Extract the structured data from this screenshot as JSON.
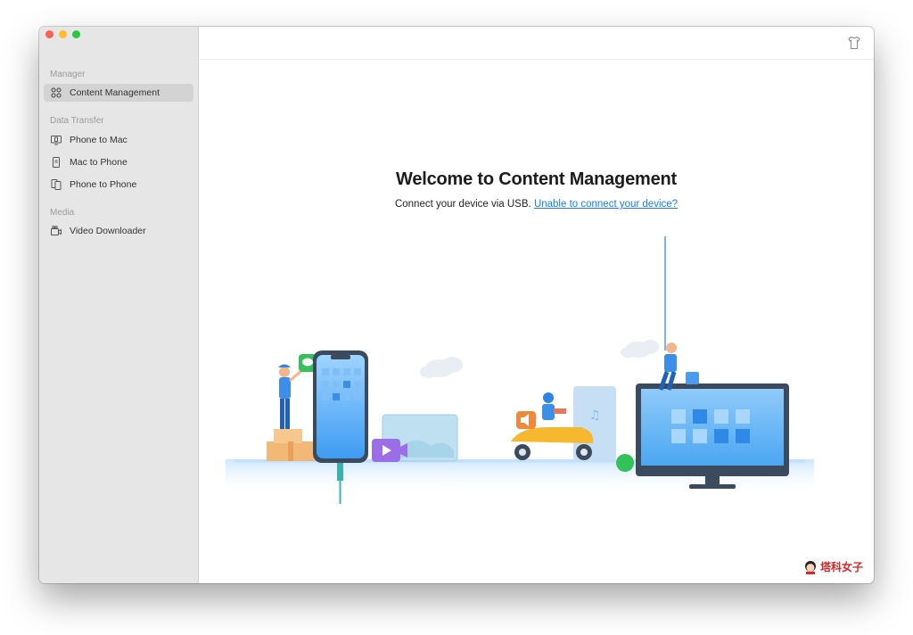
{
  "sidebar": {
    "sections": [
      {
        "label": "Manager"
      },
      {
        "label": "Data Transfer"
      },
      {
        "label": "Media"
      }
    ],
    "items": [
      {
        "label": "Content Management",
        "icon": "content-management-icon"
      },
      {
        "label": "Phone to Mac",
        "icon": "phone-to-mac-icon"
      },
      {
        "label": "Mac to Phone",
        "icon": "mac-to-phone-icon"
      },
      {
        "label": "Phone to Phone",
        "icon": "phone-to-phone-icon"
      },
      {
        "label": "Video Downloader",
        "icon": "video-downloader-icon"
      }
    ]
  },
  "main": {
    "title": "Welcome to Content Management",
    "subtitle": "Connect your device via USB.",
    "help_link": "Unable to connect your device?"
  },
  "toolbar": {
    "icon": "tshirt-icon"
  },
  "watermark": {
    "text": "塔科女子"
  },
  "colors": {
    "accent": "#1a7ef0",
    "sidebar_bg": "#e6e6e6",
    "active_item_bg": "#d3d3d3",
    "traffic_red": "#fe5f57",
    "traffic_yellow": "#febc2e",
    "traffic_green": "#28c840"
  }
}
